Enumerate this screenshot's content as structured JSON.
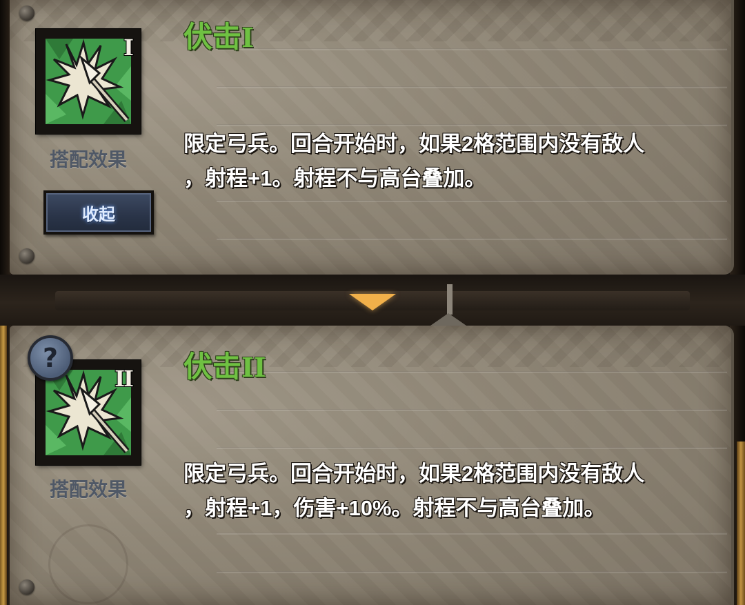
{
  "cards": [
    {
      "title": "伏击",
      "roman": "I",
      "caption": "搭配效果",
      "desc_line1": "限定弓兵。回合开始时，如果2格范围内没有敌人",
      "desc_line2": "，射程+1。射程不与高台叠加。",
      "icon": "spear-burst-icon"
    },
    {
      "title": "伏击",
      "roman": "II",
      "caption": "搭配效果",
      "desc_line1": "限定弓兵。回合开始时，如果2格范围内没有敌人",
      "desc_line2": "，射程+1，伤害+10%。射程不与高台叠加。",
      "icon": "spear-burst-icon"
    }
  ],
  "collapse_label": "收起",
  "help_label": "?",
  "colors": {
    "title_green": "#6fc142",
    "icon_green": "#3f9a4a",
    "panel": "#938a7a",
    "arrow": "#f1b04a"
  }
}
